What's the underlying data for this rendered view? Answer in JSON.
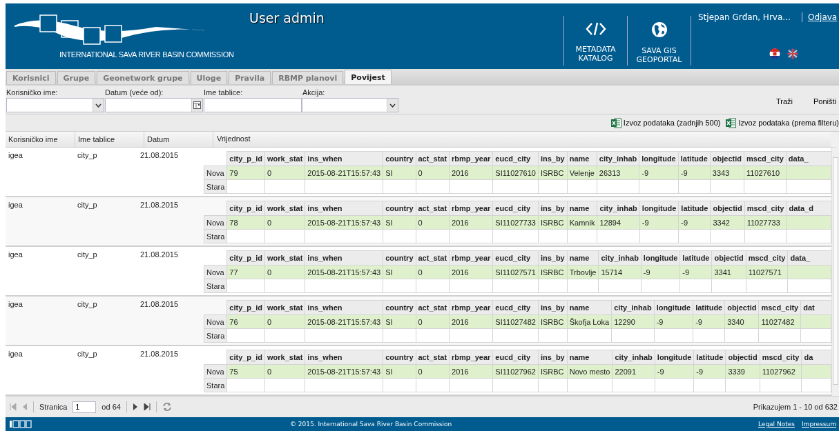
{
  "header": {
    "org": "INTERNATIONAL SAVA RIVER BASIN COMMISSION",
    "title": "User admin",
    "links": [
      {
        "kind": "code",
        "line1": "METADATA",
        "line2": "KATALOG"
      },
      {
        "kind": "globe",
        "line1": "SAVA GIS",
        "line2": "GEOPORTAL"
      }
    ],
    "user": "Stjepan Grđan, Hrva...",
    "logout": "Odjava"
  },
  "tabs": [
    {
      "label": "Korisnici",
      "selected": false
    },
    {
      "label": "Grupe",
      "selected": false
    },
    {
      "label": "Geonetwork grupe",
      "selected": false
    },
    {
      "label": "Uloge",
      "selected": false
    },
    {
      "label": "Pravila",
      "selected": false
    },
    {
      "label": "RBMP planovi",
      "selected": false
    },
    {
      "label": "Povijest",
      "selected": true
    }
  ],
  "filters": [
    {
      "label": "Korisničko ime:",
      "kind": "combo"
    },
    {
      "label": "Datum (veće od):",
      "kind": "date"
    },
    {
      "label": "Ime tablice:",
      "kind": "text"
    },
    {
      "label": "Akcija:",
      "kind": "combo"
    }
  ],
  "filter_buttons": [
    "Traži",
    "Poništi"
  ],
  "exports": [
    "Izvoz podataka (zadnjih 500)",
    "Izvoz podataka (prema filteru)"
  ],
  "columns": [
    "Korisničko ime",
    "Ime tablice",
    "Datum",
    "Vrijednost"
  ],
  "rows": [
    {
      "user": "igea",
      "table": "city_p",
      "date": "21.08.2015",
      "new_label": "Nova",
      "old_label": "Stara",
      "headers": [
        "city_p_id",
        "work_stat",
        "ins_when",
        "country",
        "act_stat",
        "rbmp_year",
        "eucd_city",
        "ins_by",
        "name",
        "city_inhab",
        "longitude",
        "latitude",
        "objectid",
        "mscd_city",
        "data_"
      ],
      "values": [
        "79",
        "0",
        "2015-08-21T15:57:43",
        "SI",
        "0",
        "2016",
        "SI11027610",
        "ISRBC",
        "Velenje",
        "26313",
        "-9",
        "-9",
        "3343",
        "11027610"
      ]
    },
    {
      "user": "igea",
      "table": "city_p",
      "date": "21.08.2015",
      "new_label": "Nova",
      "old_label": "Stara",
      "headers": [
        "city_p_id",
        "work_stat",
        "ins_when",
        "country",
        "act_stat",
        "rbmp_year",
        "eucd_city",
        "ins_by",
        "name",
        "city_inhab",
        "longitude",
        "latitude",
        "objectid",
        "mscd_city",
        "data_d"
      ],
      "values": [
        "78",
        "0",
        "2015-08-21T15:57:43",
        "SI",
        "0",
        "2016",
        "SI11027733",
        "ISRBC",
        "Kamnik",
        "12894",
        "-9",
        "-9",
        "3342",
        "11027733"
      ]
    },
    {
      "user": "igea",
      "table": "city_p",
      "date": "21.08.2015",
      "new_label": "Nova",
      "old_label": "Stara",
      "headers": [
        "city_p_id",
        "work_stat",
        "ins_when",
        "country",
        "act_stat",
        "rbmp_year",
        "eucd_city",
        "ins_by",
        "name",
        "city_inhab",
        "longitude",
        "latitude",
        "objectid",
        "mscd_city",
        "data_"
      ],
      "values": [
        "77",
        "0",
        "2015-08-21T15:57:43",
        "SI",
        "0",
        "2016",
        "SI11027571",
        "ISRBC",
        "Trbovlje",
        "15714",
        "-9",
        "-9",
        "3341",
        "11027571"
      ]
    },
    {
      "user": "igea",
      "table": "city_p",
      "date": "21.08.2015",
      "new_label": "Nova",
      "old_label": "Stara",
      "headers": [
        "city_p_id",
        "work_stat",
        "ins_when",
        "country",
        "act_stat",
        "rbmp_year",
        "eucd_city",
        "ins_by",
        "name",
        "city_inhab",
        "longitude",
        "latitude",
        "objectid",
        "mscd_city",
        "dat"
      ],
      "values": [
        "76",
        "0",
        "2015-08-21T15:57:43",
        "SI",
        "0",
        "2016",
        "SI11027482",
        "ISRBC",
        "Škofja Loka",
        "12290",
        "-9",
        "-9",
        "3340",
        "11027482"
      ]
    },
    {
      "user": "igea",
      "table": "city_p",
      "date": "21.08.2015",
      "new_label": "Nova",
      "old_label": "Stara",
      "headers": [
        "city_p_id",
        "work_stat",
        "ins_when",
        "country",
        "act_stat",
        "rbmp_year",
        "eucd_city",
        "ins_by",
        "name",
        "city_inhab",
        "longitude",
        "latitude",
        "objectid",
        "mscd_city",
        "da"
      ],
      "values": [
        "75",
        "0",
        "2015-08-21T15:57:43",
        "SI",
        "0",
        "2016",
        "SI11027962",
        "ISRBC",
        "Novo mesto",
        "22091",
        "-9",
        "-9",
        "3339",
        "11027962"
      ]
    }
  ],
  "pager": {
    "page_label": "Stranica",
    "page": "1",
    "of": "od 64",
    "summary": "Prikazujem 1 - 10 od 632"
  },
  "footer": {
    "copyright": "© 2015. International Sava River Basin Commission",
    "links": [
      "Legal Notes",
      "Impressum"
    ]
  }
}
